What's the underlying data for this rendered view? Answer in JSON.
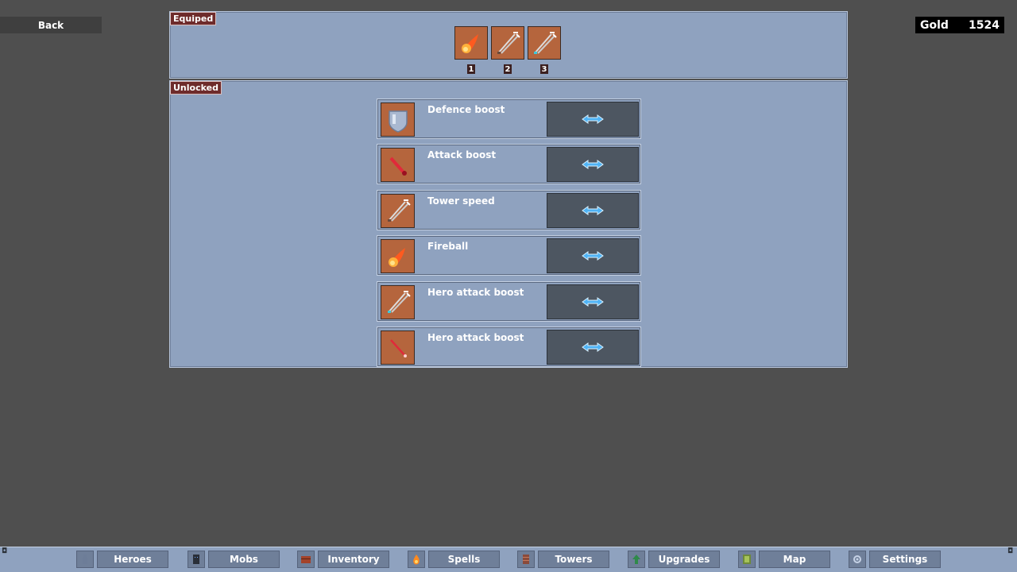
{
  "header": {
    "back_label": "Back",
    "gold_label": "Gold",
    "gold_value": "1524"
  },
  "equipped": {
    "label": "Equiped",
    "slots": [
      {
        "number": "1",
        "icon": "fireball-icon"
      },
      {
        "number": "2",
        "icon": "arrows-icon"
      },
      {
        "number": "3",
        "icon": "arrows-icon"
      }
    ]
  },
  "unlocked": {
    "label": "Unlocked",
    "spells": [
      {
        "name": "Defence boost",
        "icon": "shield-icon"
      },
      {
        "name": "Attack boost",
        "icon": "red-sword-icon"
      },
      {
        "name": "Tower speed",
        "icon": "arrows-icon"
      },
      {
        "name": "Fireball",
        "icon": "fireball-icon"
      },
      {
        "name": "Hero attack boost",
        "icon": "arrows-icon"
      },
      {
        "name": "Hero attack boost",
        "icon": "red-wand-icon"
      }
    ]
  },
  "nav": {
    "items": [
      {
        "label": "Heroes",
        "icon": "hero-icon"
      },
      {
        "label": "Mobs",
        "icon": "mob-icon"
      },
      {
        "label": "Inventory",
        "icon": "chest-icon"
      },
      {
        "label": "Spells",
        "icon": "flame-icon"
      },
      {
        "label": "Towers",
        "icon": "tower-icon"
      },
      {
        "label": "Upgrades",
        "icon": "arrow-up-icon"
      },
      {
        "label": "Map",
        "icon": "map-icon"
      },
      {
        "label": "Settings",
        "icon": "gear-icon"
      }
    ]
  },
  "colors": {
    "background": "#4f4f4f",
    "panel": "#8fa2bf",
    "icon_tile": "#b5653d",
    "button": "#4d5661",
    "label_tag": "#6e2b2b"
  }
}
